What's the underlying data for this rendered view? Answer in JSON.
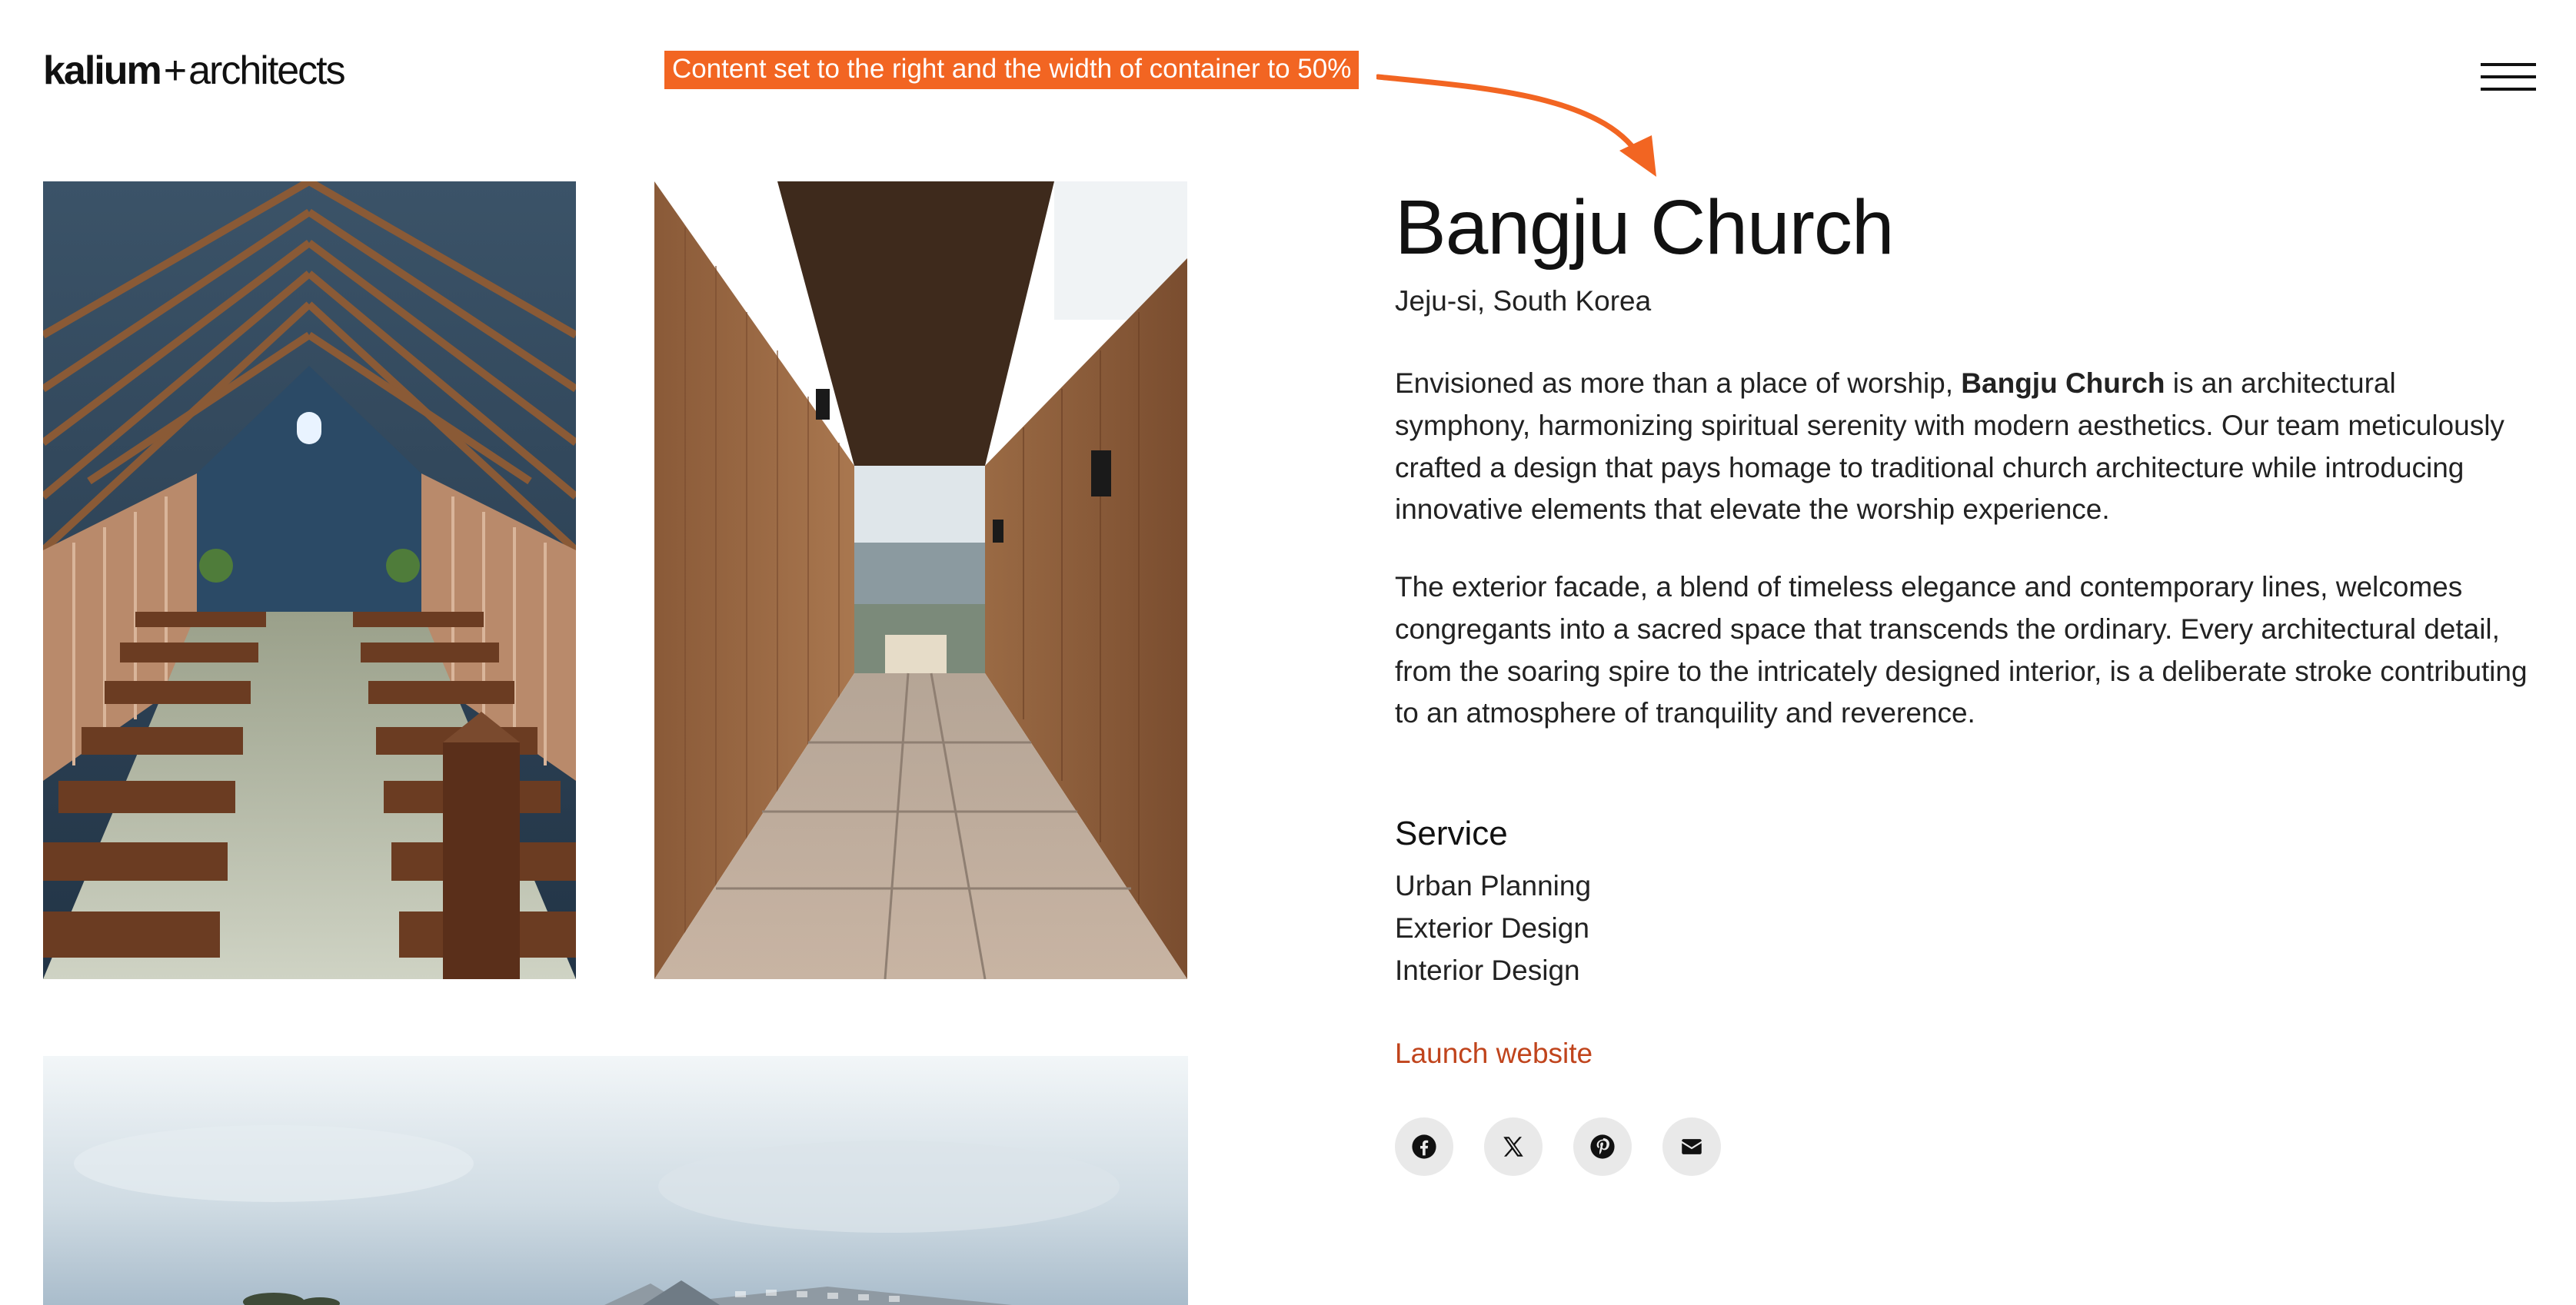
{
  "header": {
    "logo_brand": "kalium",
    "logo_plus": "+",
    "logo_suffix": "architects",
    "menu_icon": "hamburger-icon"
  },
  "annotation": {
    "text": "Content set to the right and the width of container to 50%",
    "color": "#f26522"
  },
  "gallery": {
    "images": [
      {
        "subject": "church-interior-pews"
      },
      {
        "subject": "wooden-corridor-walkway"
      },
      {
        "subject": "church-exterior-roof-sky"
      }
    ]
  },
  "project": {
    "title": "Bangju Church",
    "location": "Jeju-si, South Korea",
    "paragraph1_before": "Envisioned as more than a place of worship, ",
    "paragraph1_bold": "Bangju Church",
    "paragraph1_after": " is an architectural symphony, harmonizing spiritual serenity with modern aesthetics. Our team meticulously crafted a design that pays homage to traditional church architecture while introducing innovative elements that elevate the worship experience.",
    "paragraph2": "The exterior facade, a blend of timeless elegance and contemporary lines, welcomes congregants into a sacred space that transcends the ordinary. Every architectural detail, from the soaring spire to the intricately designed interior, is a deliberate stroke contributing to an atmosphere of tranquility and reverence."
  },
  "service": {
    "heading": "Service",
    "items": [
      "Urban Planning",
      "Exterior Design",
      "Interior Design"
    ]
  },
  "launch": {
    "label": "Launch website",
    "color": "#c0441c"
  },
  "social": {
    "icons": [
      "facebook-icon",
      "x-icon",
      "pinterest-icon",
      "email-icon"
    ]
  }
}
